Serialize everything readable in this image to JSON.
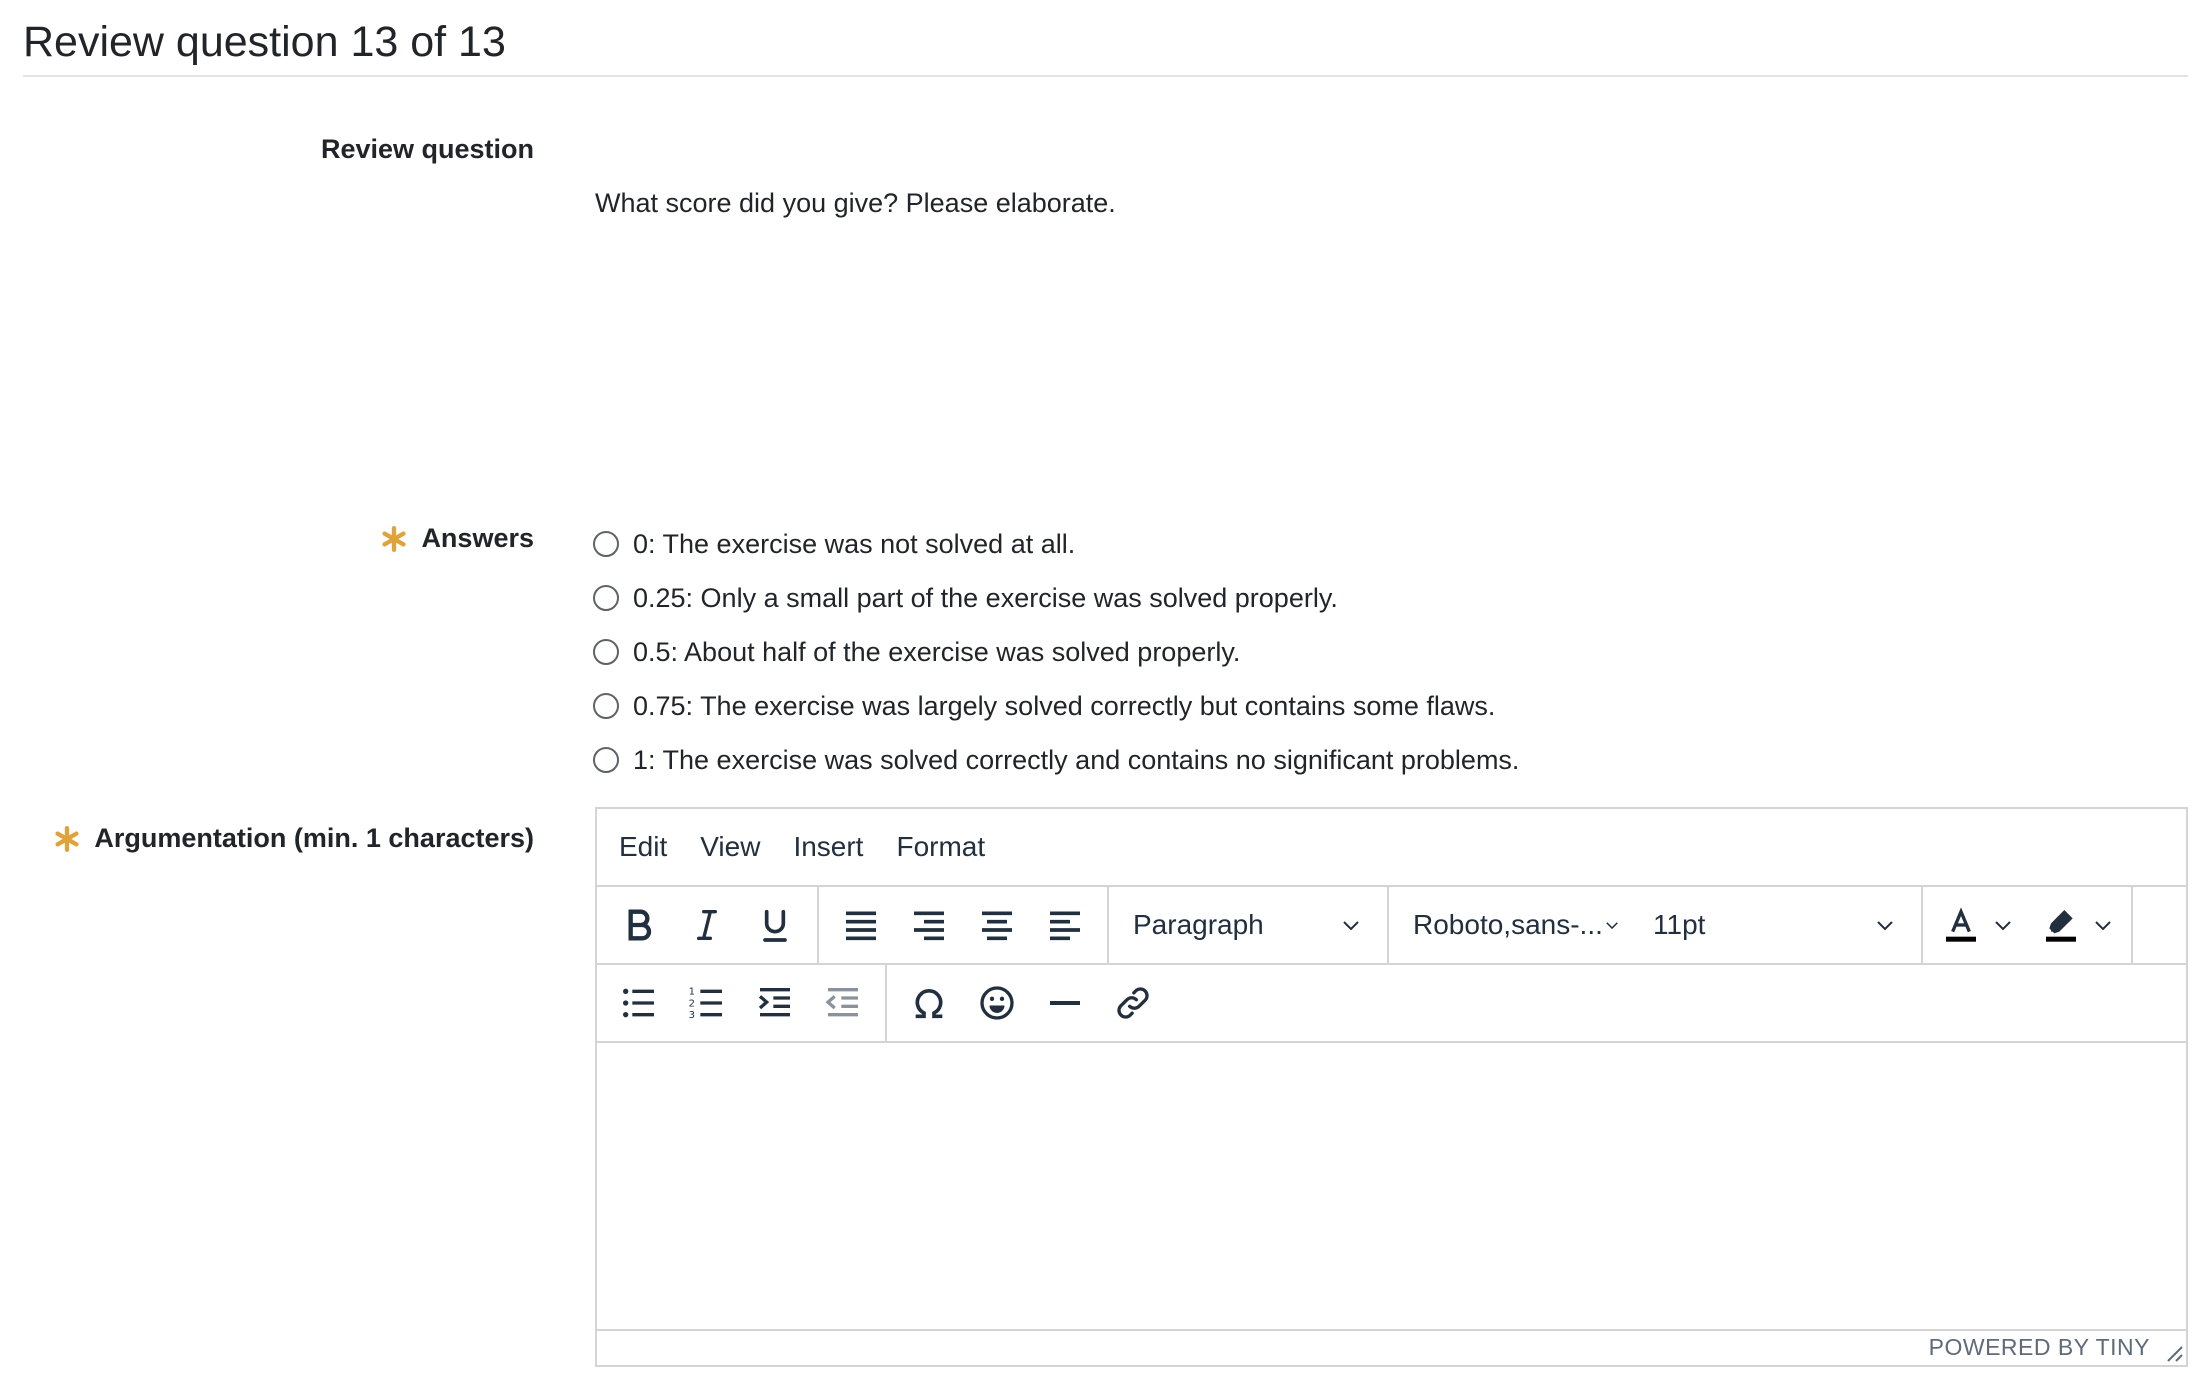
{
  "page": {
    "title": "Review question 13 of 13"
  },
  "question": {
    "label": "Review question",
    "text": "What score did you give? Please elaborate."
  },
  "answers": {
    "label": "Answers",
    "options": [
      "0: The exercise was not solved at all.",
      "0.25: Only a small part of the exercise was solved properly.",
      "0.5: About half of the exercise was solved properly.",
      "0.75: The exercise was largely solved correctly but contains some flaws.",
      "1: The exercise was solved correctly and contains no significant problems."
    ]
  },
  "argumentation": {
    "label": "Argumentation (min. 1 characters)"
  },
  "editor": {
    "menu": [
      "Edit",
      "View",
      "Insert",
      "Format"
    ],
    "block_format": "Paragraph",
    "font_family": "Roboto,sans-...",
    "font_size": "11pt",
    "branding": "POWERED BY TINY",
    "icons": {
      "row1": [
        "bold-icon",
        "italic-icon",
        "underline-icon",
        "align-justify-icon",
        "align-right-icon",
        "align-center-icon",
        "align-left-icon",
        "text-color-icon",
        "highlight-color-icon"
      ],
      "row2": [
        "bullet-list-icon",
        "numbered-list-icon",
        "indent-icon",
        "outdent-icon",
        "special-character-icon",
        "emoji-icon",
        "horizontal-rule-icon",
        "link-icon"
      ]
    }
  },
  "colors": {
    "required": "#e0a33b",
    "text": "#212529",
    "editor_text": "#222f3e",
    "border": "#d4d4d4"
  }
}
